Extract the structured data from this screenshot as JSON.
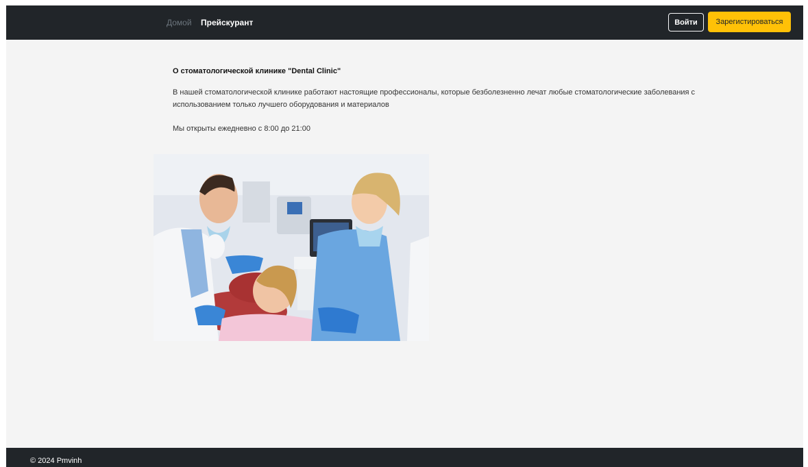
{
  "nav": {
    "home": "Домой",
    "pricelist": "Прейскурант",
    "login": "Войти",
    "register": "Зарегистироваться"
  },
  "about": {
    "title": "О стоматологической клинике \"Dental Clinic\"",
    "text": "В нашей стоматологической клинике работают настоящие профессионалы, которые безболезненно лечат любые стоматологические заболевания с использованием только лучшего оборудования и материалов",
    "hours": "Мы открыты ежедневно с 8:00 до 21:00"
  },
  "footer": {
    "copyright": "© 2024 Pmvinh"
  },
  "colors": {
    "navbar": "#212529",
    "accent": "#ffc107",
    "background": "#f4f4f4"
  }
}
